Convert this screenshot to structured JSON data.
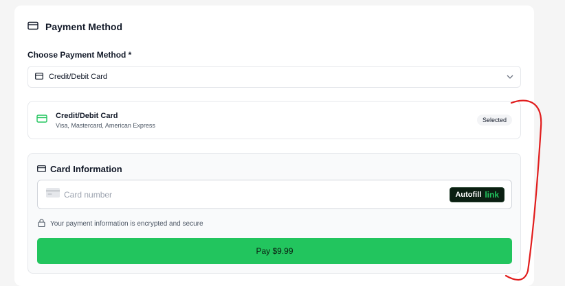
{
  "header": {
    "title": "Payment Method",
    "icon": "credit-card-icon"
  },
  "method_select": {
    "label": "Choose Payment Method *",
    "value": "Credit/Debit Card",
    "icon": "credit-card-icon",
    "chevron_icon": "chevron-down-icon"
  },
  "selected_method": {
    "title": "Credit/Debit Card",
    "subtitle": "Visa, Mastercard, American Express",
    "badge": "Selected",
    "icon": "credit-card-icon",
    "icon_color": "#22c55e"
  },
  "card_info": {
    "title": "Card Information",
    "card_number_placeholder": "Card number",
    "autofill_label": "Autofill",
    "autofill_brand": "link",
    "secure_text": "Your payment information is encrypted and secure",
    "pay_label": "Pay $9.99"
  },
  "colors": {
    "accent": "#22c55e",
    "annotation": "#e11d1d"
  }
}
